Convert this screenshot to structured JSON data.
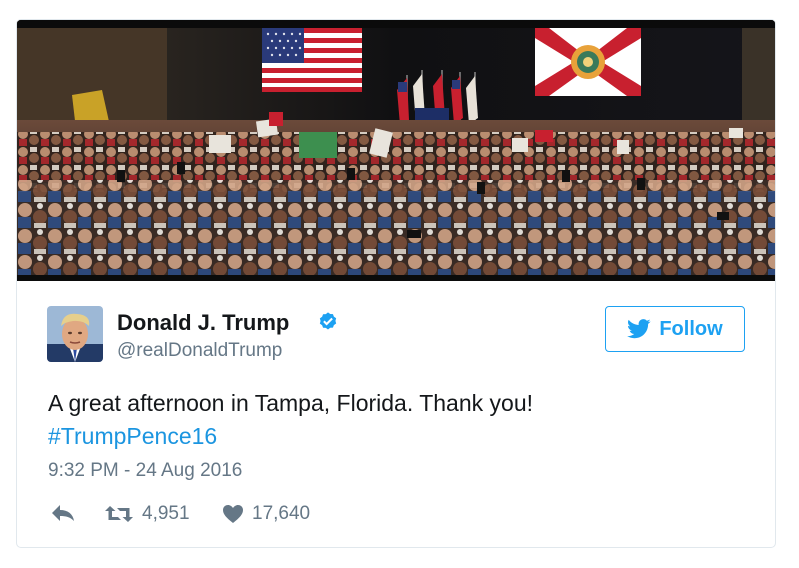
{
  "tweet": {
    "author": {
      "name": "Donald J. Trump",
      "handle": "@realDonaldTrump",
      "verified": true
    },
    "follow_button": {
      "label": "Follow",
      "icon": "twitter-bird-icon"
    },
    "text": "A great afternoon in Tampa, Florida. Thank you!",
    "hashtag": "#TrumpPence16",
    "timestamp": "9:32 PM - 24 Aug 2016",
    "actions": {
      "reply": {
        "icon": "reply-icon"
      },
      "retweet": {
        "icon": "retweet-icon",
        "count": "4,951"
      },
      "like": {
        "icon": "heart-icon",
        "count": "17,640"
      }
    }
  },
  "colors": {
    "brand_blue": "#1da1f2",
    "hashtag_blue": "#1b95e0",
    "text_dark": "#14171a",
    "text_muted": "#657786",
    "border": "#e1e8ed"
  }
}
